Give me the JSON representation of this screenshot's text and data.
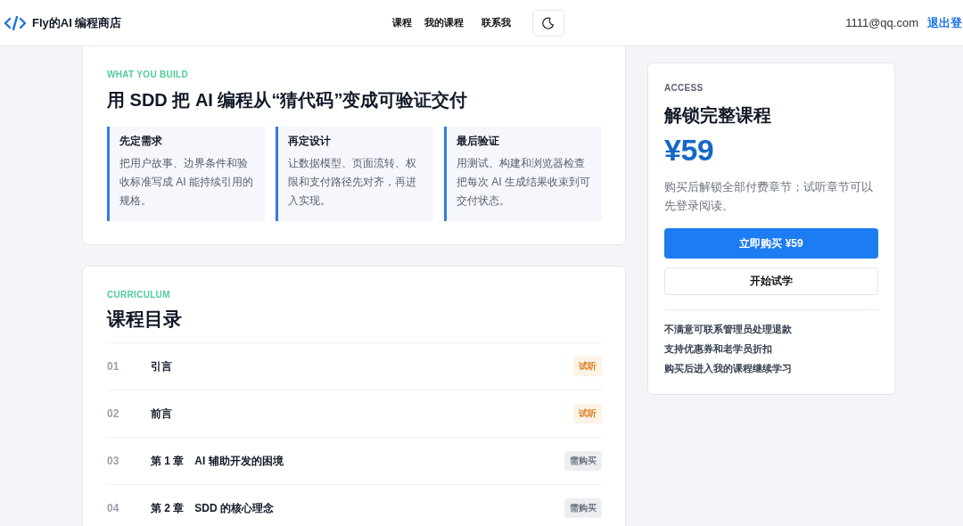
{
  "header": {
    "logo_text": "Fly的AI 编程商店",
    "nav": [
      {
        "label": "课程"
      },
      {
        "label": "我的课程"
      },
      {
        "label": "联系我"
      }
    ],
    "email": "1111@qq.com",
    "logout": "退出登"
  },
  "intro": {
    "eyebrow": "WHAT YOU BUILD",
    "title": "用 SDD 把 AI 编程从“猜代码”变成可验证交付",
    "steps": [
      {
        "title": "先定需求",
        "text": "把用户故事、边界条件和验收标准写成 AI 能持续引用的规格。"
      },
      {
        "title": "再定设计",
        "text": "让数据模型、页面流转、权限和支付路径先对齐，再进入实现。"
      },
      {
        "title": "最后验证",
        "text": "用测试、构建和浏览器检查把每次 AI 生成结果收束到可交付状态。"
      }
    ]
  },
  "curriculum": {
    "eyebrow": "CURRICULUM",
    "title": "课程目录",
    "lessons": [
      {
        "number": "01",
        "title": "引言",
        "badge": "试听",
        "kind": "trial"
      },
      {
        "number": "02",
        "title": "前言",
        "badge": "试听",
        "kind": "trial"
      },
      {
        "number": "03",
        "title": "第 1 章　AI 辅助开发的困境",
        "badge": "需购买",
        "kind": "paid"
      },
      {
        "number": "04",
        "title": "第 2 章　SDD 的核心理念",
        "badge": "需购买",
        "kind": "paid"
      }
    ]
  },
  "access": {
    "eyebrow": "ACCESS",
    "title": "解锁完整课程",
    "price": "¥59",
    "description": "购买后解锁全部付费章节；试听章节可以先登录阅读。",
    "buy_button": "立即购买 ¥59",
    "trial_button": "开始试学",
    "notes": [
      "不满意可联系管理员处理退款",
      "支持优惠券和老学员折扣",
      "购买后进入我的课程继续学习"
    ]
  }
}
